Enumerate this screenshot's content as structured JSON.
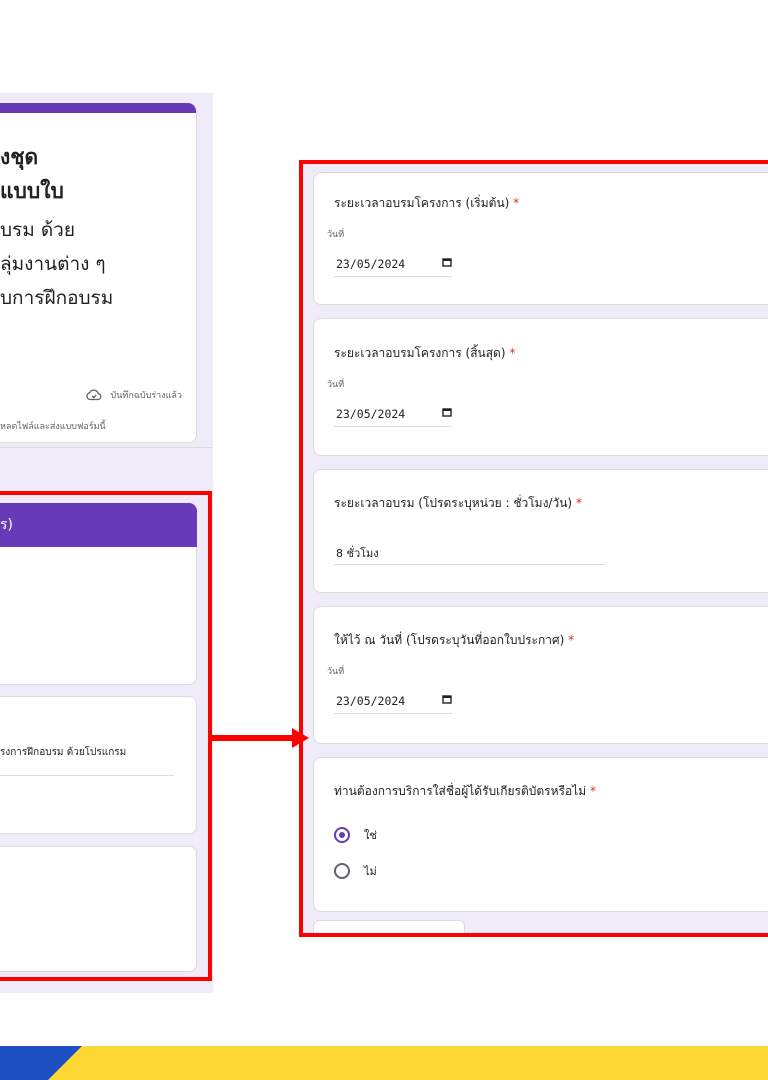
{
  "left_form": {
    "title_lines": [
      "งชุด",
      "แบบใบ",
      "บรม ด้วย",
      "ลุ่มงานต่าง ๆ",
      "บการฝึกอบรม"
    ],
    "draft_status": "บันทึกฉบับร่างแล้ว",
    "upload_notice": "หลดไฟล์และส่งแบบฟอร์มนี้",
    "section_title": "ร)",
    "question_fragment": "รงการฝึกอบรม ด้วยโปรแกรม"
  },
  "right_form": {
    "questions": [
      {
        "label": "ระยะเวลาอบรมโครงการ (เริ่มต้น)",
        "required_mark": "*",
        "date_caption": "วันที่",
        "value": "23/05/2024"
      },
      {
        "label": "ระยะเวลาอบรมโครงการ (สิ้นสุด)",
        "required_mark": "*",
        "date_caption": "วันที่",
        "value": "23/05/2024"
      },
      {
        "label": "ระยะเวลาอบรม (โปรดระบุหน่วย : ชั่วโมง/วัน)",
        "required_mark": "*",
        "value": "8 ชั่วโมง"
      },
      {
        "label": "ให้ไว้ ณ วันที่ (โปรดระบุวันที่ออกใบประกาศ)",
        "required_mark": "*",
        "date_caption": "วันที่",
        "value": "23/05/2024"
      },
      {
        "label": "ท่านต้องการบริการใส่ชื่อผู้ได้รับเกียรติบัตรหรือไม่",
        "required_mark": "*",
        "options": [
          "ใช่",
          "ไม่"
        ],
        "selected": "ใช่"
      }
    ]
  },
  "colors": {
    "accent": "#673ab7",
    "highlight_red": "#ff0000",
    "footer_yellow": "#fdd835",
    "footer_blue": "#1e4fc2",
    "form_background": "#f0ebf8"
  },
  "icons": [
    "cloud-check-icon",
    "calendar-icon",
    "arrow-right-icon"
  ]
}
